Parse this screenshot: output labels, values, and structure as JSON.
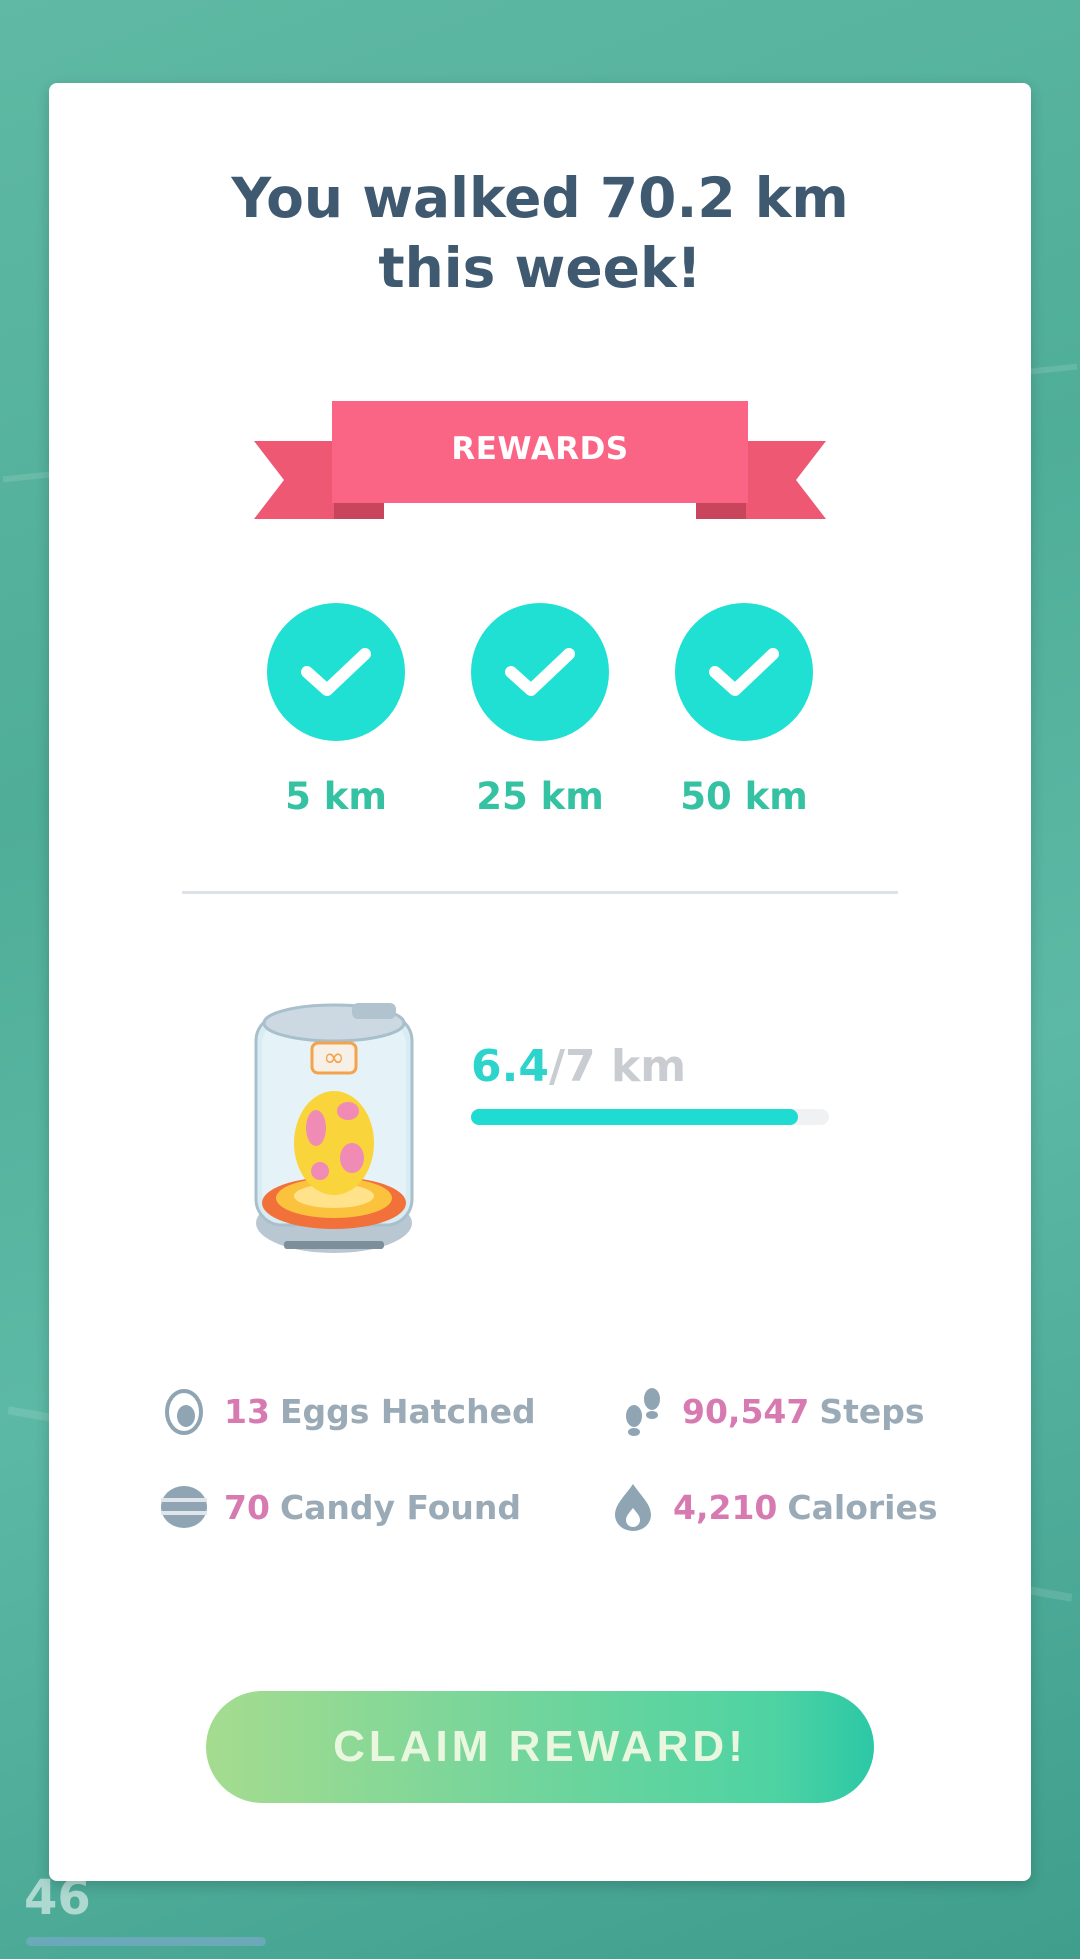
{
  "title": "You walked 70.2 km\nthis week!",
  "rewards_banner": "REWARDS",
  "milestones": [
    {
      "label": "5 km",
      "completed": true
    },
    {
      "label": "25 km",
      "completed": true
    },
    {
      "label": "50 km",
      "completed": true
    }
  ],
  "egg_progress": {
    "current": "6.4",
    "total": "/7 km",
    "fraction": 0.914
  },
  "stats": {
    "eggs": {
      "value": "13",
      "label": "Eggs Hatched",
      "icon": "egg-icon"
    },
    "steps": {
      "value": "90,547",
      "label": "Steps",
      "icon": "footprints-icon"
    },
    "candy": {
      "value": "70",
      "label": "Candy Found",
      "icon": "candy-icon"
    },
    "calories": {
      "value": "4,210",
      "label": "Calories",
      "icon": "flame-icon"
    }
  },
  "claim_button": "CLAIM REWARD!",
  "background": {
    "level": "46"
  },
  "colors": {
    "accent_teal": "#1fe0d2",
    "ribbon_pink": "#f9637f",
    "stat_value_pink": "#d77ab1",
    "title_text": "#3f5a70"
  }
}
